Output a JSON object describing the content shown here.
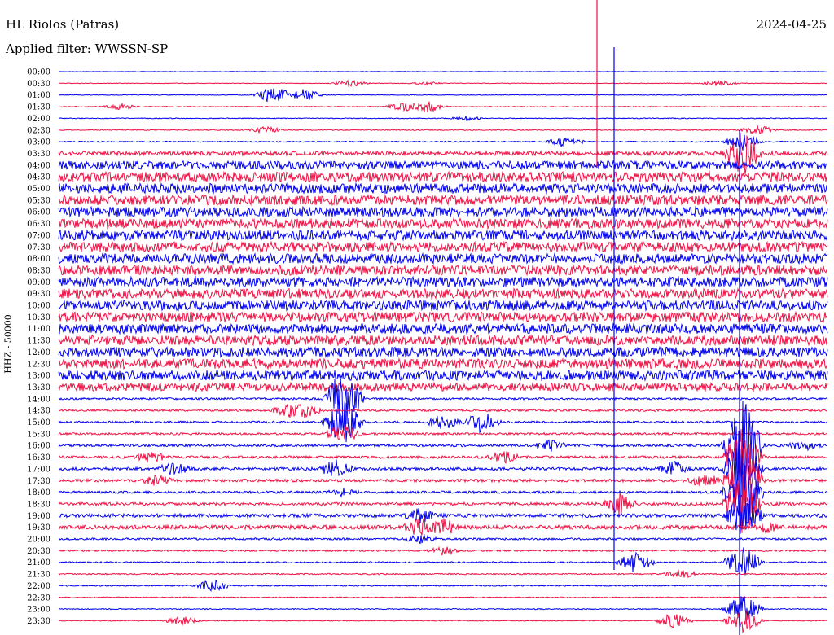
{
  "header": {
    "station": "HL Riolos (Patras)",
    "filter": "Applied filter: WWSSN-SP",
    "date": "2024-04-25"
  },
  "chart_data": {
    "type": "line",
    "title": "HL Riolos (Patras)",
    "subtitle": "Applied filter: WWSSN-SP",
    "date": "2024-04-25",
    "ylabel": "HHZ - 50000",
    "row_labels": [
      "00:00",
      "00:30",
      "01:00",
      "01:30",
      "02:00",
      "02:30",
      "03:00",
      "03:30",
      "04:00",
      "04:30",
      "05:00",
      "05:30",
      "06:00",
      "06:30",
      "07:00",
      "07:30",
      "08:00",
      "08:30",
      "09:00",
      "09:30",
      "10:00",
      "10:30",
      "11:00",
      "11:30",
      "12:00",
      "12:30",
      "13:00",
      "13:30",
      "14:00",
      "14:30",
      "15:00",
      "15:30",
      "16:00",
      "16:30",
      "17:00",
      "17:30",
      "18:00",
      "18:30",
      "19:00",
      "19:30",
      "20:00",
      "20:30",
      "21:00",
      "21:30",
      "22:00",
      "22:30",
      "23:00",
      "23:30"
    ],
    "series_colors": [
      "#0000ee",
      "#ee1144"
    ],
    "noise_level": [
      0.3,
      0.4,
      0.4,
      0.5,
      0.5,
      0.6,
      0.7,
      2.5,
      5,
      6,
      6,
      6,
      6,
      6,
      6,
      6,
      6,
      6,
      6,
      6,
      6,
      6,
      6,
      6,
      6,
      6,
      6,
      5,
      1.2,
      1.2,
      1.3,
      1.3,
      1.5,
      1.6,
      1.8,
      1.8,
      1.5,
      1.8,
      2.2,
      2.5,
      1.2,
      1.0,
      0.9,
      0.8,
      0.7,
      0.6,
      0.6,
      0.5
    ],
    "events": [
      {
        "row": 1,
        "x": 0.38,
        "amp": 4
      },
      {
        "row": 1,
        "x": 0.86,
        "amp": 4
      },
      {
        "row": 1,
        "x": 0.48,
        "amp": 2
      },
      {
        "row": 2,
        "x": 0.28,
        "amp": 12
      },
      {
        "row": 2,
        "x": 0.32,
        "amp": 8
      },
      {
        "row": 3,
        "x": 0.08,
        "amp": 4
      },
      {
        "row": 3,
        "x": 0.45,
        "amp": 6
      },
      {
        "row": 3,
        "x": 0.48,
        "amp": 7
      },
      {
        "row": 4,
        "x": 0.53,
        "amp": 3
      },
      {
        "row": 5,
        "x": 0.27,
        "amp": 5
      },
      {
        "row": 5,
        "x": 0.91,
        "amp": 6
      },
      {
        "row": 6,
        "x": 0.66,
        "amp": 8
      },
      {
        "row": 6,
        "x": 0.89,
        "amp": 12
      },
      {
        "row": 7,
        "x": 0.89,
        "amp": 30
      },
      {
        "row": 28,
        "x": 0.37,
        "amp": 40
      },
      {
        "row": 29,
        "x": 0.3,
        "amp": 10
      },
      {
        "row": 29,
        "x": 0.32,
        "amp": 10
      },
      {
        "row": 30,
        "x": 0.37,
        "amp": 30
      },
      {
        "row": 30,
        "x": 0.55,
        "amp": 14
      },
      {
        "row": 30,
        "x": 0.5,
        "amp": 10
      },
      {
        "row": 31,
        "x": 0.37,
        "amp": 14
      },
      {
        "row": 32,
        "x": 0.64,
        "amp": 8
      },
      {
        "row": 32,
        "x": 0.89,
        "amp": 60
      },
      {
        "row": 32,
        "x": 0.97,
        "amp": 8
      },
      {
        "row": 33,
        "x": 0.12,
        "amp": 8
      },
      {
        "row": 33,
        "x": 0.58,
        "amp": 8
      },
      {
        "row": 33,
        "x": 0.89,
        "amp": 40
      },
      {
        "row": 34,
        "x": 0.15,
        "amp": 10
      },
      {
        "row": 34,
        "x": 0.36,
        "amp": 12
      },
      {
        "row": 34,
        "x": 0.8,
        "amp": 10
      },
      {
        "row": 34,
        "x": 0.89,
        "amp": 40
      },
      {
        "row": 35,
        "x": 0.13,
        "amp": 8
      },
      {
        "row": 35,
        "x": 0.84,
        "amp": 10
      },
      {
        "row": 35,
        "x": 0.89,
        "amp": 50
      },
      {
        "row": 36,
        "x": 0.37,
        "amp": 6
      },
      {
        "row": 36,
        "x": 0.89,
        "amp": 50
      },
      {
        "row": 37,
        "x": 0.73,
        "amp": 14
      },
      {
        "row": 37,
        "x": 0.89,
        "amp": 40
      },
      {
        "row": 38,
        "x": 0.47,
        "amp": 10
      },
      {
        "row": 38,
        "x": 0.89,
        "amp": 30
      },
      {
        "row": 39,
        "x": 0.47,
        "amp": 14
      },
      {
        "row": 39,
        "x": 0.5,
        "amp": 12
      },
      {
        "row": 39,
        "x": 0.92,
        "amp": 8
      },
      {
        "row": 40,
        "x": 0.47,
        "amp": 6
      },
      {
        "row": 41,
        "x": 0.5,
        "amp": 6
      },
      {
        "row": 42,
        "x": 0.75,
        "amp": 14
      },
      {
        "row": 42,
        "x": 0.89,
        "amp": 20
      },
      {
        "row": 43,
        "x": 0.81,
        "amp": 6
      },
      {
        "row": 44,
        "x": 0.2,
        "amp": 8
      },
      {
        "row": 46,
        "x": 0.89,
        "amp": 20
      },
      {
        "row": 47,
        "x": 0.16,
        "amp": 6
      },
      {
        "row": 47,
        "x": 0.8,
        "amp": 10
      },
      {
        "row": 47,
        "x": 0.89,
        "amp": 15
      }
    ]
  }
}
